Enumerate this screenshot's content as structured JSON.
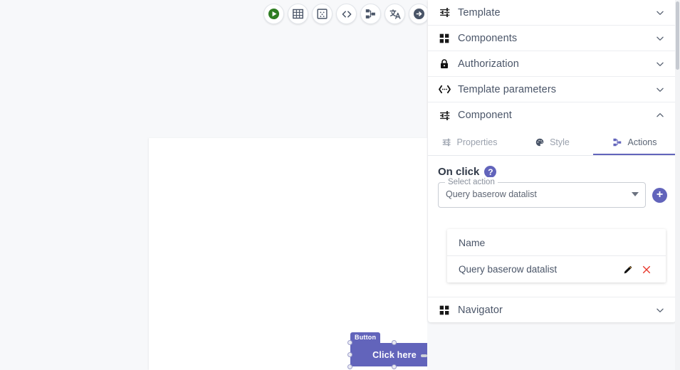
{
  "toolbar": {
    "buttons": [
      {
        "name": "preview-run-icon",
        "title": "Run"
      },
      {
        "name": "grid-table-icon",
        "title": "Table"
      },
      {
        "name": "layout-panel-icon",
        "title": "Layout"
      },
      {
        "name": "code-brackets-icon",
        "title": "Code"
      },
      {
        "name": "sitemap-icon",
        "title": "Structure"
      },
      {
        "name": "translate-icon",
        "title": "Translate"
      },
      {
        "name": "arrow-right-circle-icon",
        "title": "Next"
      }
    ]
  },
  "canvas": {
    "component_tag": "Button",
    "button_label": "Click here"
  },
  "panel": {
    "sections": [
      {
        "label": "Template",
        "icon": "sliders-icon",
        "expanded": false
      },
      {
        "label": "Components",
        "icon": "grid-squares-icon",
        "expanded": false
      },
      {
        "label": "Authorization",
        "icon": "lock-icon",
        "expanded": false
      },
      {
        "label": "Template parameters",
        "icon": "angle-dots-icon",
        "expanded": false
      },
      {
        "label": "Component",
        "icon": "sliders-icon",
        "expanded": true
      }
    ],
    "navigator": {
      "label": "Navigator",
      "icon": "grid-squares-icon",
      "expanded": false
    },
    "component": {
      "tabs": [
        {
          "label": "Properties",
          "icon": "sliders-icon",
          "active": false
        },
        {
          "label": "Style",
          "icon": "palette-icon",
          "active": false
        },
        {
          "label": "Actions",
          "icon": "sitemap-icon",
          "active": true
        }
      ],
      "on_click_label": "On click",
      "help_glyph": "?",
      "select": {
        "legend": "Select action",
        "value": "Query baserow datalist",
        "options": [
          "Query baserow datalist"
        ]
      },
      "add_button_glyph": "+",
      "actions_table": {
        "columns": [
          "Name"
        ],
        "rows": [
          {
            "name": "Query baserow datalist",
            "edit": "edit-icon",
            "delete": "delete-icon"
          }
        ]
      }
    }
  },
  "colors": {
    "accent": "#6264bb",
    "component_fill": "#6264bb",
    "delete_red": "#e8392d",
    "page_bg": "#f7f8fa",
    "run_green": "#2e7d22"
  }
}
